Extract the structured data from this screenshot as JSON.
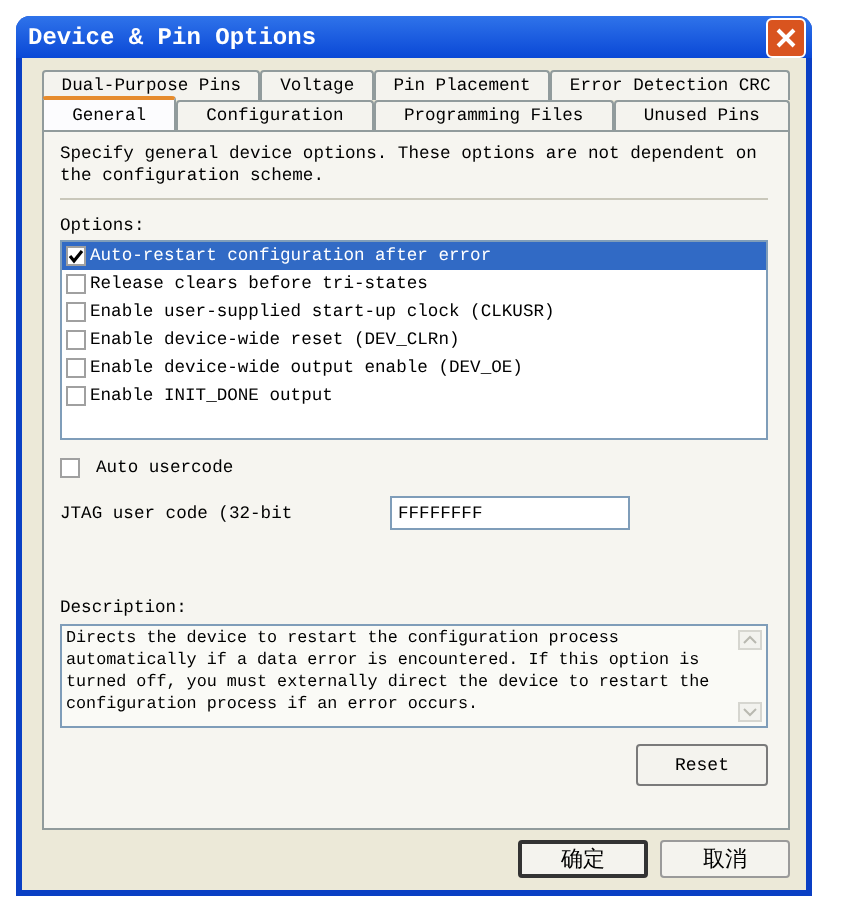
{
  "window": {
    "title": "Device & Pin Options"
  },
  "tabs_back": [
    {
      "label": "Dual-Purpose Pins",
      "selected": false
    },
    {
      "label": "Voltage",
      "selected": false
    },
    {
      "label": "Pin Placement",
      "selected": false
    },
    {
      "label": "Error Detection CRC",
      "selected": false
    }
  ],
  "tabs_front": [
    {
      "label": "General",
      "selected": true
    },
    {
      "label": "Configuration",
      "selected": false
    },
    {
      "label": "Programming Files",
      "selected": false
    },
    {
      "label": "Unused Pins",
      "selected": false
    }
  ],
  "intro": "Specify general device options.  These options are not dependent on the configuration scheme.",
  "options": {
    "label": "Options:",
    "items": [
      {
        "label": "Auto-restart configuration after error",
        "checked": true,
        "selected": true
      },
      {
        "label": "Release clears before tri-states",
        "checked": false,
        "selected": false
      },
      {
        "label": "Enable user-supplied start-up clock (CLKUSR)",
        "checked": false,
        "selected": false
      },
      {
        "label": "Enable device-wide reset (DEV_CLRn)",
        "checked": false,
        "selected": false
      },
      {
        "label": "Enable device-wide output enable (DEV_OE)",
        "checked": false,
        "selected": false
      },
      {
        "label": "Enable INIT_DONE output",
        "checked": false,
        "selected": false
      }
    ]
  },
  "auto_usercode": {
    "label": "Auto usercode",
    "checked": false
  },
  "jtag": {
    "label": "JTAG user code (32-bit",
    "value": "FFFFFFFF"
  },
  "description": {
    "label": "Description:",
    "text": "Directs the device to restart the configuration process automatically if a data error is encountered. If this option is turned off, you must externally direct the device to restart the configuration process if an error occurs."
  },
  "reset_button": "Reset",
  "dialog_buttons": [
    {
      "label": "确定",
      "focused": true
    },
    {
      "label": "取消",
      "focused": false
    }
  ]
}
